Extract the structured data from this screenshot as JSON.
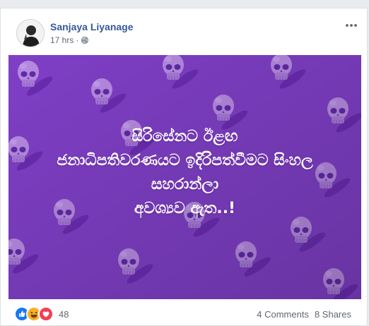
{
  "post": {
    "author": "Sanjaya Liyanage",
    "timestamp": "17 hrs",
    "separator": "·",
    "privacy_icon": "globe-icon",
    "more_icon": "more-options-icon"
  },
  "image": {
    "background_color": "#7f3fc6",
    "decor_icon": "skull-icon",
    "text_lines": [
      "සිරිසේනට ඊළඟ",
      "ජනාධිපතිවරණයට ඉදිරිපත්වීමට සිංහල",
      "සහරාන්ලා",
      "අවශ්‍යව ඇත..!"
    ]
  },
  "footer": {
    "reaction_icons": [
      "like-icon",
      "haha-icon",
      "love-icon"
    ],
    "reaction_count": "48",
    "comments_label": "4 Comments",
    "shares_label": "8 Shares"
  },
  "colors": {
    "name_link": "#365899",
    "meta": "#616770",
    "like": "#1877f2",
    "haha": "#f7b125",
    "love": "#f33e58"
  }
}
